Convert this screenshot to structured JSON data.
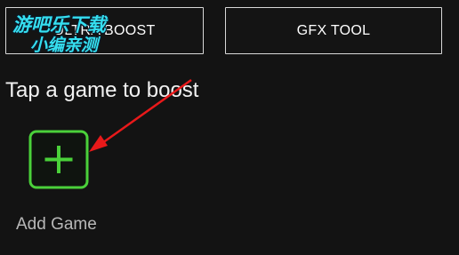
{
  "header": {
    "ultra_boost_label": "ULTRA BOOST",
    "gfx_tool_label": "GFX TOOL"
  },
  "watermark": {
    "line1": "游吧乐下载",
    "line2": "小编亲测"
  },
  "main": {
    "title": "Tap a game to boost",
    "add_game_label": "Add Game",
    "add_icon": "plus-icon"
  },
  "colors": {
    "background": "#131313",
    "accent_green": "#4ad13a",
    "annotation_arrow": "#e8191a",
    "watermark": "#35dff0"
  }
}
